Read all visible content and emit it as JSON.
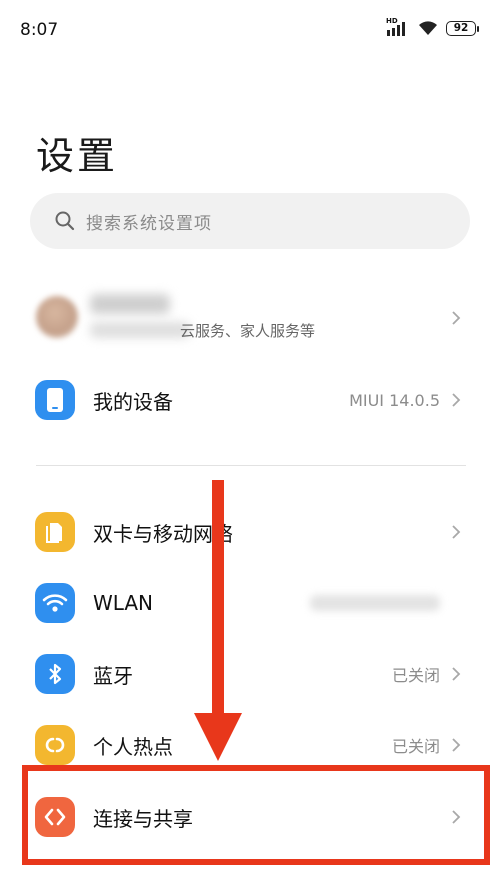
{
  "status_bar": {
    "time": "8:07",
    "network": "HD",
    "battery": "92"
  },
  "page": {
    "title": "设置"
  },
  "search": {
    "placeholder": "搜索系统设置项"
  },
  "account": {
    "subtitle": "云服务、家人服务等"
  },
  "rows": [
    {
      "label": "我的设备",
      "value": "MIUI 14.0.5",
      "icon": "phone-icon",
      "color": "#2f8fef"
    },
    {
      "label": "双卡与移动网络",
      "value": "",
      "icon": "sim-card-icon",
      "color": "#f3b72f"
    },
    {
      "label": "WLAN",
      "value": "",
      "icon": "wifi-icon",
      "color": "#2f8fef"
    },
    {
      "label": "蓝牙",
      "value": "已关闭",
      "icon": "bluetooth-icon",
      "color": "#2f8fef"
    },
    {
      "label": "个人热点",
      "value": "已关闭",
      "icon": "hotspot-icon",
      "color": "#f3b72f"
    },
    {
      "label": "连接与共享",
      "value": "",
      "icon": "connection-sharing-icon",
      "color": "#f0663f"
    }
  ],
  "annotation": {
    "color": "#e8371b"
  }
}
